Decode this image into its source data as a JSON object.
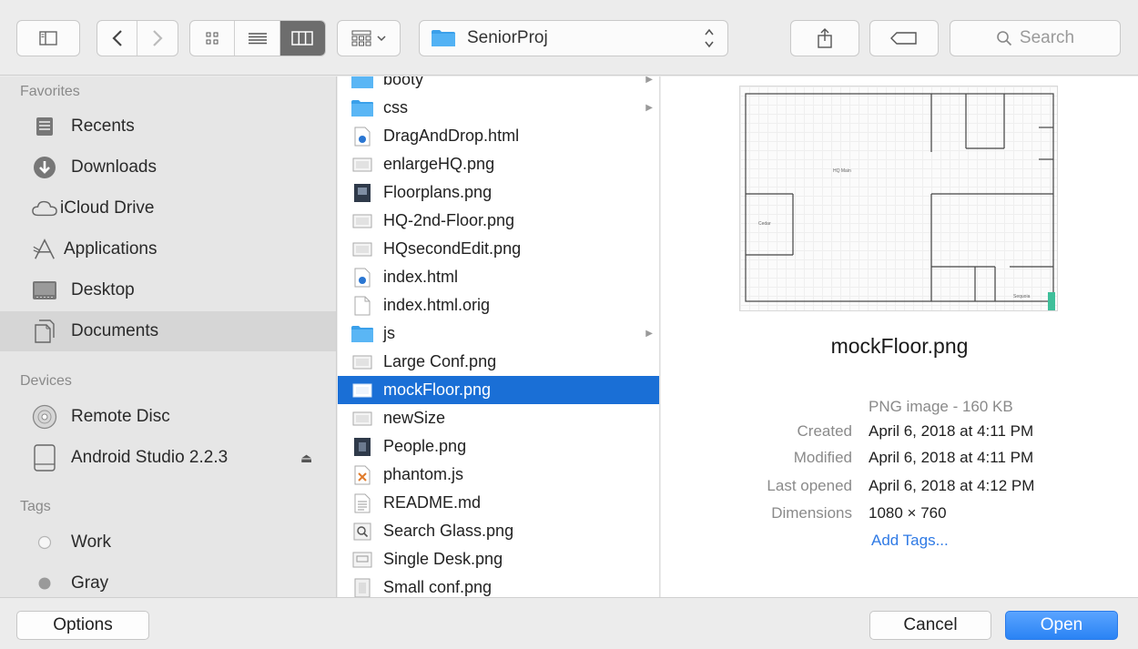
{
  "toolbar": {
    "path_label": "SeniorProj",
    "search_placeholder": "Search"
  },
  "sidebar": {
    "favorites_header": "Favorites",
    "favorites": [
      {
        "label": "Recents",
        "icon": "recents-icon"
      },
      {
        "label": "Downloads",
        "icon": "downloads-icon"
      },
      {
        "label": "iCloud Drive",
        "icon": "cloud-icon"
      },
      {
        "label": "Applications",
        "icon": "applications-icon"
      },
      {
        "label": "Desktop",
        "icon": "desktop-icon"
      },
      {
        "label": "Documents",
        "icon": "documents-icon",
        "selected": true
      }
    ],
    "devices_header": "Devices",
    "devices": [
      {
        "label": "Remote Disc",
        "icon": "disc-icon"
      },
      {
        "label": "Android Studio 2.2.3",
        "icon": "drive-icon"
      }
    ],
    "tags_header": "Tags",
    "tags": [
      {
        "label": "Work",
        "color": "#ffffff"
      },
      {
        "label": "Gray",
        "color": "#9a9a9a"
      }
    ]
  },
  "files": [
    {
      "name": "booty",
      "kind": "folder"
    },
    {
      "name": "css",
      "kind": "folder"
    },
    {
      "name": "DragAndDrop.html",
      "kind": "html"
    },
    {
      "name": "enlargeHQ.png",
      "kind": "png"
    },
    {
      "name": "Floorplans.png",
      "kind": "png-dark"
    },
    {
      "name": "HQ-2nd-Floor.png",
      "kind": "png"
    },
    {
      "name": "HQsecondEdit.png",
      "kind": "png"
    },
    {
      "name": "index.html",
      "kind": "html"
    },
    {
      "name": "index.html.orig",
      "kind": "doc"
    },
    {
      "name": "js",
      "kind": "folder"
    },
    {
      "name": "Large Conf.png",
      "kind": "png"
    },
    {
      "name": "mockFloor.png",
      "kind": "png",
      "selected": true
    },
    {
      "name": "newSize",
      "kind": "png"
    },
    {
      "name": "People.png",
      "kind": "png-dark"
    },
    {
      "name": "phantom.js",
      "kind": "js"
    },
    {
      "name": "README.md",
      "kind": "text"
    },
    {
      "name": "Search Glass.png",
      "kind": "png-search"
    },
    {
      "name": "Single Desk.png",
      "kind": "png"
    },
    {
      "name": "Small conf.png",
      "kind": "png"
    }
  ],
  "preview": {
    "file_name": "mockFloor.png",
    "kind": "PNG image - 160 KB",
    "thumb_labels": {
      "a": "HQ Main",
      "b": "Cedar",
      "c": "Sequoia"
    },
    "meta": [
      {
        "key": "Created",
        "value": "April 6, 2018 at 4:11 PM"
      },
      {
        "key": "Modified",
        "value": "April 6, 2018 at 4:11 PM"
      },
      {
        "key": "Last opened",
        "value": "April 6, 2018 at 4:12 PM"
      },
      {
        "key": "Dimensions",
        "value": "1080 × 760"
      }
    ],
    "add_tags": "Add Tags..."
  },
  "buttons": {
    "options": "Options",
    "cancel": "Cancel",
    "open": "Open"
  },
  "colors": {
    "selection": "#1a6fd6",
    "folder": "#3aa0ea",
    "link": "#2f7ae5",
    "primary_button": "#2a83f4"
  }
}
